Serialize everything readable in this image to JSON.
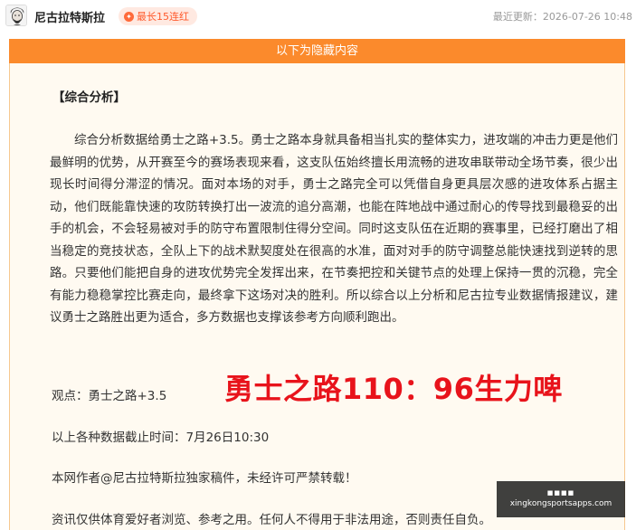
{
  "header": {
    "author": "尼古拉特斯拉",
    "badge": "最长15连红",
    "updated": "最近更新：2026-07-26 10:48"
  },
  "hidden": {
    "banner": "以下为隐藏内容"
  },
  "article": {
    "section_title": "【综合分析】",
    "paragraph": "综合分析数据给勇士之路+3.5。勇士之路本身就具备相当扎实的整体实力，进攻端的冲击力更是他们最鲜明的优势，从开赛至今的赛场表现来看，这支队伍始终擅长用流畅的进攻串联带动全场节奏，很少出现长时间得分滞涩的情况。面对本场的对手，勇士之路完全可以凭借自身更具层次感的进攻体系占据主动，他们既能靠快速的攻防转换打出一波流的追分高潮，也能在阵地战中通过耐心的传导找到最稳妥的出手的机会，不会轻易被对手的防守布置限制住得分空间。同时这支队伍在近期的赛事里，已经打磨出了相当稳定的竞技状态，全队上下的战术默契度处在很高的水准，面对对手的防守调整总能快速找到逆转的思路。只要他们能把自身的进攻优势完全发挥出来，在节奏把控和关键节点的处理上保持一贯的沉稳，完全有能力稳稳掌控比赛走向，最终拿下这场对决的胜利。所以综合以上分析和尼古拉专业数据情报建议，建议勇士之路胜出更为适合，多方数据也支撑该参考方向顺利跑出。",
    "view": "观点：勇士之路+3.5",
    "score": "勇士之路110：96生力啤",
    "cutoff": "以上各种数据截止时间：7月26日10:30",
    "copyright": "本网作者@尼古拉特斯拉独家稿件，未经许可严禁转载！",
    "disclaimer": "资讯仅供体育爱好者浏览、参考之用。任何人不得用于非法用途，否则责任自负。"
  },
  "watermark": {
    "top": "■■■■",
    "url": "xingkongsportsapps.com"
  },
  "colors": {
    "banner": "#fb8a2c",
    "score": "#e8131b",
    "badge_text": "#ff5a2c",
    "box_bg": "#fffaf1"
  }
}
